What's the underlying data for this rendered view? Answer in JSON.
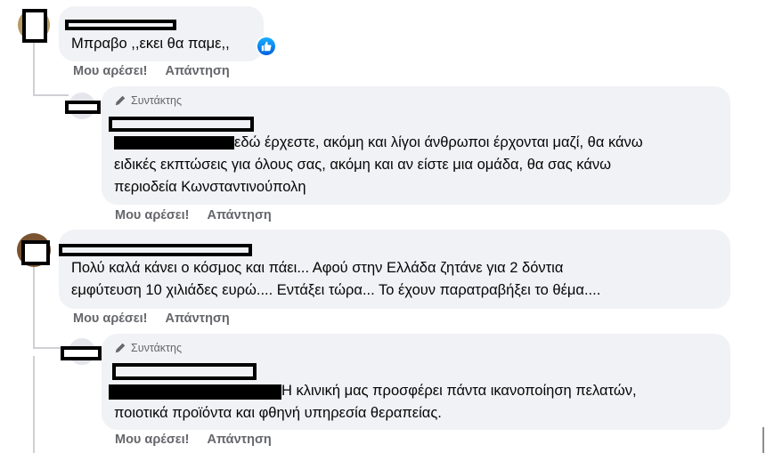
{
  "comments": [
    {
      "author_tag": "",
      "lines": [
        "Μπραβο ,,εκει θα παμε,,"
      ],
      "reaction_icon": "like-icon",
      "like_label": "Μου αρέσει!",
      "reply_label": "Απάντηση"
    },
    {
      "author_tag": "Συντάκτης",
      "lines": [
        "εδώ έρχεστε, ακόμη και λίγοι άνθρωποι έρχονται μαζί, θα κάνω",
        "ειδικές εκπτώσεις για όλους σας, ακόμη και αν είστε μια ομάδα, θα σας κάνω",
        "περιοδεία Κωνσταντινούπολη"
      ],
      "like_label": "Μου αρέσει!",
      "reply_label": "Απάντηση"
    },
    {
      "author_tag": "",
      "lines": [
        "Πολύ καλά κάνει ο κόσμος και πάει... Αφού στην Ελλάδα ζητάνε για 2 δόντια",
        "εμφύτευση 10 χιλιάδες ευρώ.... Εντάξει τώρα... Το έχουν παρατραβήξει το θέμα...."
      ],
      "like_label": "Μου αρέσει!",
      "reply_label": "Απάντηση"
    },
    {
      "author_tag": "Συντάκτης",
      "lines": [
        "Η κλινική μας προσφέρει πάντα ικανοποίηση πελατών,",
        "ποιοτικά προϊόντα και φθηνή υπηρεσία θεραπείας."
      ],
      "like_label": "Μου αρέσει!",
      "reply_label": "Απάντηση"
    }
  ],
  "colors": {
    "bubble": "#f0f2f5",
    "meta_text": "#65676b",
    "body_text": "#050505",
    "thread_line": "#ced0d4",
    "like_blue": "#0866ff"
  }
}
